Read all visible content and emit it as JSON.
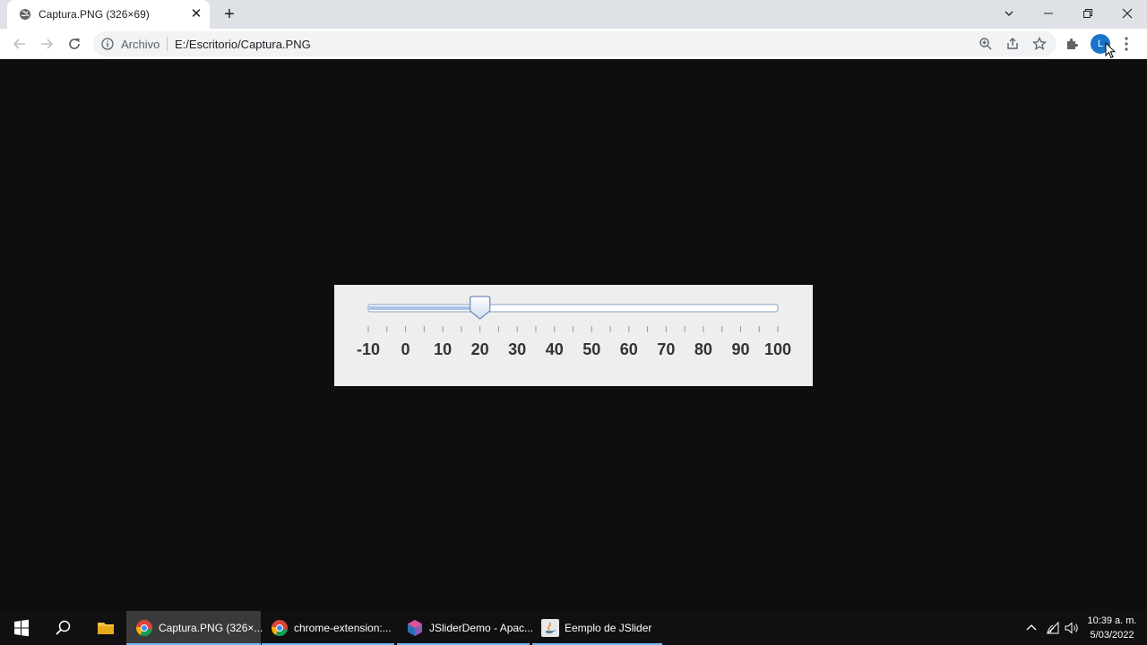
{
  "browser": {
    "tab": {
      "title": "Captura.PNG (326×69)"
    },
    "address": {
      "site_label": "Archivo",
      "url": "E:/Escritorio/Captura.PNG"
    },
    "profile_initial": "L"
  },
  "slider": {
    "min": -10,
    "max": 100,
    "value": 20,
    "tick_labels": [
      "-10",
      "0",
      "10",
      "20",
      "30",
      "40",
      "50",
      "60",
      "70",
      "80",
      "90",
      "100"
    ]
  },
  "taskbar": {
    "apps": [
      {
        "label": "Captura.PNG (326×...",
        "icon": "chrome-icon",
        "active": true
      },
      {
        "label": "chrome-extension:...",
        "icon": "chrome-icon",
        "active": false
      },
      {
        "label": "JSliderDemo - Apac...",
        "icon": "netbeans-icon",
        "active": false
      },
      {
        "label": "Eemplo de JSlider",
        "icon": "java-icon",
        "active": false
      }
    ],
    "clock": {
      "time": "10:39 a. m.",
      "date": "5/03/2022"
    }
  },
  "colors": {
    "tabstrip": "#dee1e6",
    "taskbar": "#101010",
    "taskbar_accent": "#76b9ed",
    "slider_fill": "#a8c4e6",
    "slider_border": "#6e8fb8"
  }
}
